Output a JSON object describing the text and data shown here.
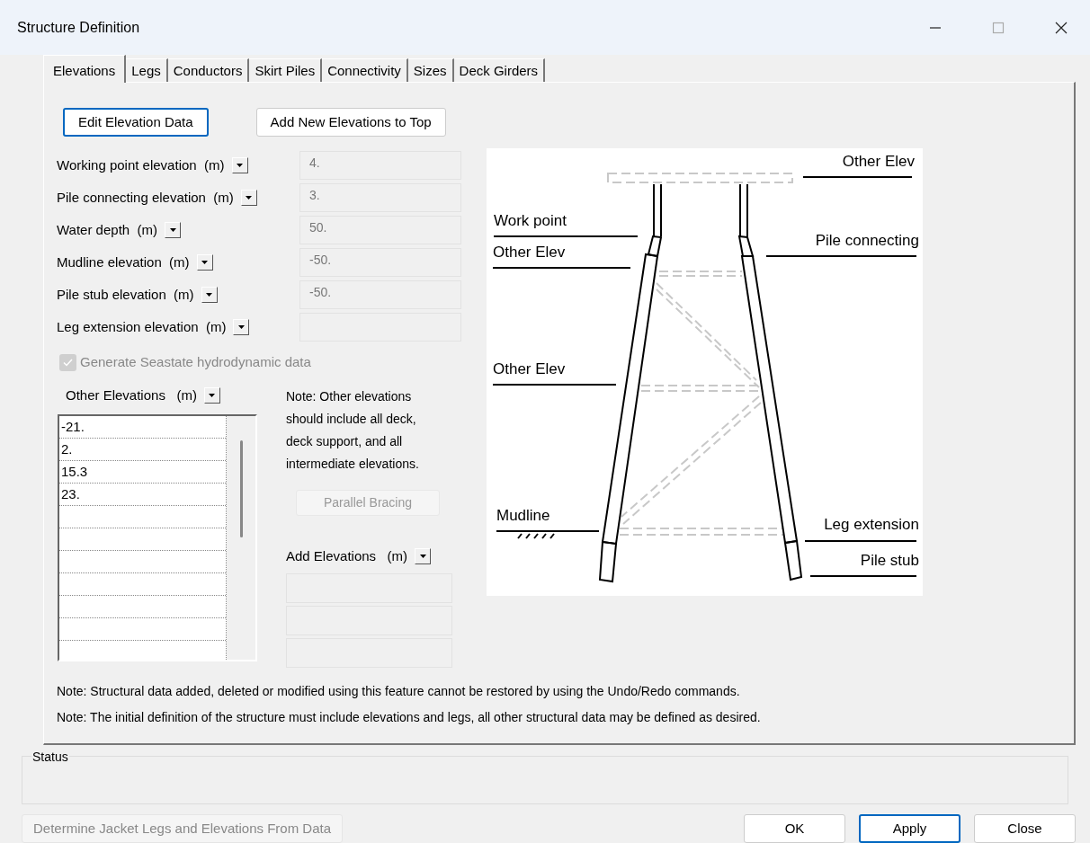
{
  "window": {
    "title": "Structure Definition"
  },
  "tabs": [
    {
      "label": "Elevations",
      "selected": true
    },
    {
      "label": "Legs",
      "selected": false
    },
    {
      "label": "Conductors",
      "selected": false
    },
    {
      "label": "Skirt Piles",
      "selected": false
    },
    {
      "label": "Connectivity",
      "selected": false
    },
    {
      "label": "Sizes",
      "selected": false
    },
    {
      "label": "Deck Girders",
      "selected": false
    }
  ],
  "top_buttons": [
    {
      "label": "Edit Elevation Data",
      "focused": true
    },
    {
      "label": "Add New Elevations to Top",
      "focused": false
    }
  ],
  "fields": [
    {
      "label": "Working point elevation",
      "unit": "(m)",
      "value": "4."
    },
    {
      "label": "Pile connecting elevation",
      "unit": "(m)",
      "value": "3."
    },
    {
      "label": "Water depth",
      "unit": "(m)",
      "value": "50."
    },
    {
      "label": "Mudline elevation",
      "unit": "(m)",
      "value": "-50."
    },
    {
      "label": "Pile stub elevation",
      "unit": "(m)",
      "value": "-50."
    },
    {
      "label": "Leg extension elevation",
      "unit": "(m)"
    }
  ],
  "seastate_checkbox": {
    "label": "Generate Seastate hydrodynamic data",
    "checked": true,
    "disabled": true
  },
  "other_elevations": {
    "label": "Other Elevations",
    "unit": "(m)",
    "rows": [
      "-21.",
      "2.",
      "15.3",
      "23."
    ]
  },
  "note": "Note:  Other elevations should include all deck, deck support, and all intermediate elevations.",
  "parallel_bracing_button": {
    "label": "Parallel Bracing",
    "disabled": true
  },
  "add_elevations": {
    "label": "Add Elevations",
    "unit": "(m)"
  },
  "diagram": {
    "labels": [
      "Other Elev",
      "Work point",
      "Other Elev",
      "Pile connecting",
      "Other Elev",
      "Mudline",
      "Leg extension",
      "Pile stub"
    ]
  },
  "notes": [
    "Note: Structural data added, deleted or modified using this feature cannot be restored by using the Undo/Redo commands.",
    "Note: The initial definition of the structure must include elevations and legs, all other structural data may be defined as desired."
  ],
  "status": {
    "label": "Status"
  },
  "bottom_buttons": [
    {
      "label": "Determine Jacket Legs and Elevations From Data",
      "disabled": true,
      "default": false
    },
    {
      "label": "OK",
      "disabled": false,
      "default": false
    },
    {
      "label": "Apply",
      "disabled": false,
      "default": true
    },
    {
      "label": "Close",
      "disabled": false,
      "default": false
    }
  ]
}
